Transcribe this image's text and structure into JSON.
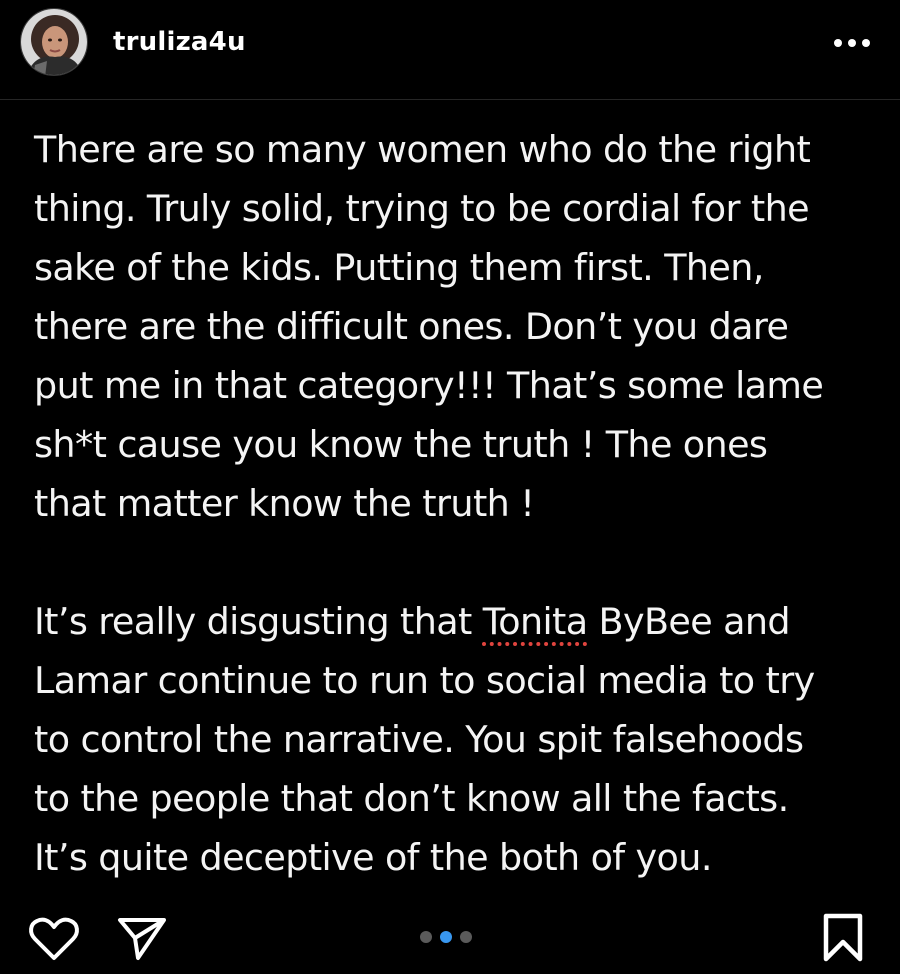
{
  "post": {
    "username": "truliza4u",
    "paragraph1": "There are so many women who do the right\nthing. Truly solid, trying to be cordial for the\nsake of the kids. Putting them first. Then,\nthere are the difficult ones. Don’t you dare\nput me in that category!!! That’s some lame\nsh*t cause you know the truth ! The ones\nthat matter know the truth !",
    "paragraph2_before": "It’s really disgusting that ",
    "paragraph2_misspelled": "Tonita",
    "paragraph2_after": " ByBee and\nLamar continue to run to social media to try\nto control the narrative. You spit falsehoods\nto the people that don’t know all the facts.\nIt’s quite deceptive of the both of you."
  },
  "icons": {
    "more": "more-horizontal-icon",
    "like": "heart-icon",
    "share": "paper-plane-icon",
    "save": "bookmark-icon"
  },
  "carousel": {
    "count": 3,
    "active_index": 1
  },
  "colors": {
    "background": "#000000",
    "text": "#ffffff",
    "active_dot": "#3897f0",
    "inactive_dot": "#5a5a5a",
    "spellcheck_underline": "#e0443e"
  }
}
